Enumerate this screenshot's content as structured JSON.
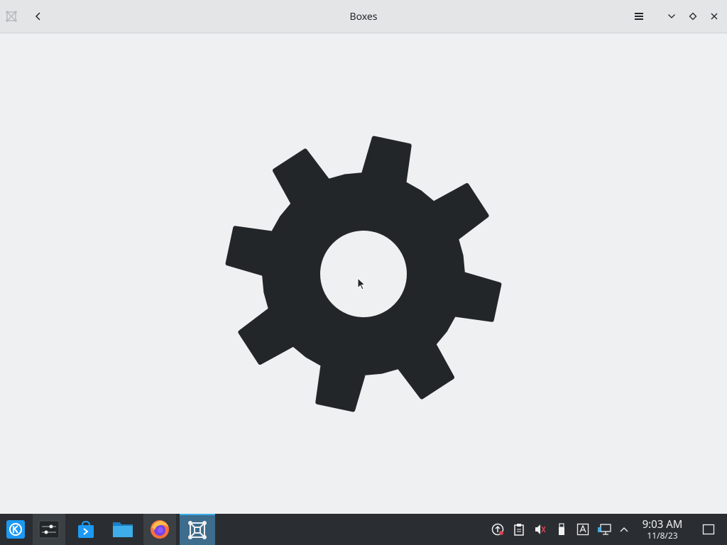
{
  "window": {
    "title": "Boxes"
  },
  "titlebar": {
    "app_icon": "boxes-icon",
    "back_icon": "chevron-left-icon",
    "menu_icon": "hamburger-menu-icon",
    "minimize_icon": "chevron-down-icon",
    "maximize_icon": "diamond-icon",
    "close_icon": "close-icon"
  },
  "content": {
    "illustration": "gear-icon",
    "gear_color": "#232629"
  },
  "taskbar": {
    "launcher_icon": "kde-launcher-icon",
    "tasks": [
      {
        "name": "system-settings",
        "icon": "settings-sliders-icon"
      },
      {
        "name": "discover",
        "icon": "store-bag-icon"
      },
      {
        "name": "dolphin",
        "icon": "folder-icon"
      },
      {
        "name": "firefox",
        "icon": "firefox-icon"
      },
      {
        "name": "boxes",
        "icon": "boxes-icon"
      }
    ],
    "tray_icons": [
      "updates-icon",
      "clipboard-icon",
      "volume-muted-icon",
      "usb-icon",
      "keyboard-layout-icon",
      "network-icon",
      "expand-arrow-icon"
    ],
    "clock": {
      "time": "9:03 AM",
      "date": "11/8/23"
    },
    "show_desktop_icon": "show-desktop-icon"
  },
  "colors": {
    "background": "#eff0f1",
    "taskbar": "#2a2e32",
    "accent": "#3daee9"
  }
}
